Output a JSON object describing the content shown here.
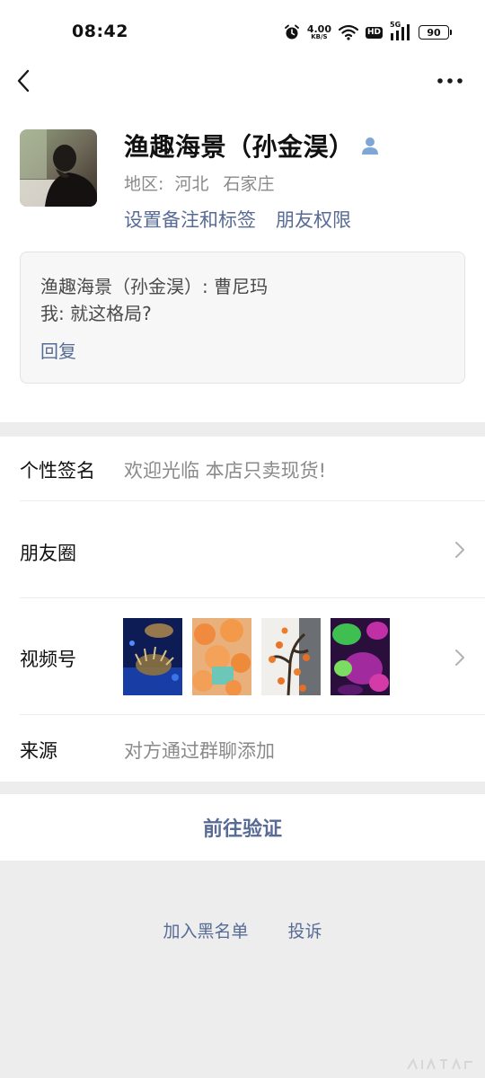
{
  "status_bar": {
    "time": "08:42",
    "net_speed_value": "4.00",
    "net_speed_unit": "KB/S",
    "hd_label": "HD",
    "network_label": "5G",
    "battery_level": "90"
  },
  "nav": {
    "back_icon": "chevron-left-icon",
    "more_icon": "more-horizontal-icon"
  },
  "profile": {
    "name": "渔趣海景（孙金淏）",
    "region_label": "地区:",
    "region_province": "河北",
    "region_city": "石家庄",
    "set_remark_label": "设置备注和标签",
    "friend_permission_label": "朋友权限"
  },
  "message_card": {
    "line1": "渔趣海景（孙金淏）: 曹尼玛",
    "line2": "我: 就这格局?",
    "reply_label": "回复"
  },
  "details": {
    "signature_label": "个性签名",
    "signature_value": "欢迎光临 本店只卖现货!",
    "moments_label": "朋友圈",
    "channels_label": "视频号",
    "source_label": "来源",
    "source_value": "对方通过群聊添加"
  },
  "actions": {
    "verify_label": "前往验证",
    "blacklist_label": "加入黑名单",
    "report_label": "投诉"
  },
  "colors": {
    "link": "#576b95",
    "background": "#ededed",
    "card": "#f7f7f7"
  }
}
